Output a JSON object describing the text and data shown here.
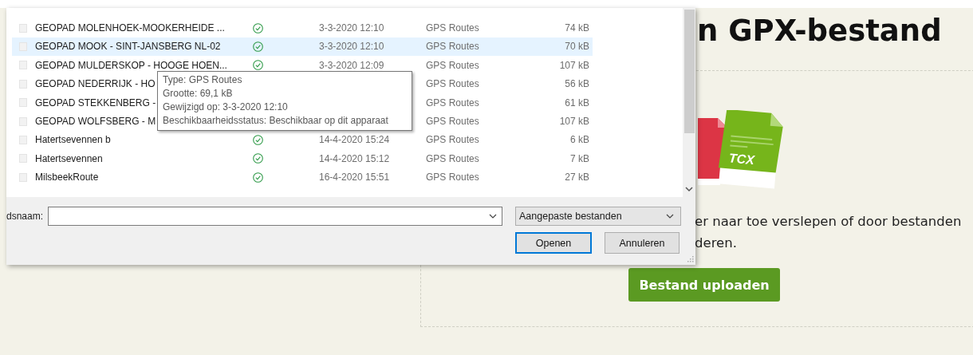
{
  "page": {
    "heading": "n GPX-bestand",
    "file_icons": [
      {
        "kind": "red"
      },
      {
        "kind": "green",
        "label": "TCX"
      }
    ],
    "description_lines": [
      "er naar toe verslepen of door bestanden",
      "deren."
    ],
    "upload_button": "Bestand uploaden"
  },
  "file_dialog": {
    "rows": [
      {
        "name": "GEOPAD MOLENHOEK-MOOKERHEIDE ...",
        "synced": true,
        "date": "3-3-2020 12:10",
        "type": "GPS Routes",
        "size": "74 kB",
        "selected": false
      },
      {
        "name": "GEOPAD MOOK - SINT-JANSBERG NL-02",
        "synced": true,
        "date": "3-3-2020 12:10",
        "type": "GPS Routes",
        "size": "70 kB",
        "selected": true
      },
      {
        "name": "GEOPAD MULDERSKOP - HOOGE HOEN...",
        "synced": true,
        "date": "3-3-2020 12:09",
        "type": "GPS Routes",
        "size": "107 kB",
        "selected": false
      },
      {
        "name": "GEOPAD NEDERRIJK - HO",
        "type": "GPS Routes",
        "size": "56 kB",
        "selected": false
      },
      {
        "name": "GEOPAD STEKKENBERG -",
        "type": "GPS Routes",
        "size": "61 kB",
        "selected": false
      },
      {
        "name": "GEOPAD WOLFSBERG - M",
        "type": "GPS Routes",
        "size": "107 kB",
        "selected": false
      },
      {
        "name": "Hatertsevennen b",
        "synced": true,
        "date": "14-4-2020 15:24",
        "type": "GPS Routes",
        "size": "6 kB",
        "selected": false
      },
      {
        "name": "Hatertsevennen",
        "synced": true,
        "date": "14-4-2020 15:12",
        "type": "GPS Routes",
        "size": "7 kB",
        "selected": false
      },
      {
        "name": "MilsbeekRoute",
        "synced": true,
        "date": "16-4-2020 15:51",
        "type": "GPS Routes",
        "size": "27 kB",
        "selected": false
      }
    ],
    "tooltip": [
      "Type: GPS Routes",
      "Grootte: 69,1 kB",
      "Gewijzigd op: 3-3-2020 12:10",
      "Beschikbaarheidsstatus: Beschikbaar op dit apparaat"
    ],
    "file_name_label": "dsnaam:",
    "file_type": "Aangepaste bestanden",
    "buttons": [
      {
        "label": "Openen",
        "default": true
      },
      {
        "label": "Annuleren",
        "default": false
      }
    ]
  }
}
